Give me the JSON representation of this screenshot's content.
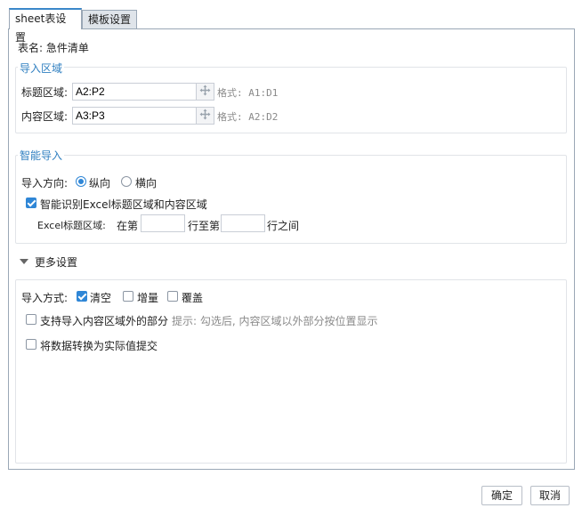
{
  "tabs": [
    {
      "label": "sheet表设置",
      "active": true
    },
    {
      "label": "模板设置",
      "active": false
    }
  ],
  "table_name": "表名: 急件清单",
  "import_area": {
    "title": "导入区域",
    "title_row": {
      "label": "标题区域:",
      "value": "A2:P2",
      "format": "格式: A1:D1"
    },
    "content_row": {
      "label": "内容区域:",
      "value": "A3:P3",
      "format": "格式: A2:D2"
    }
  },
  "smart_import": {
    "title": "智能导入",
    "direction_label": "导入方向:",
    "direction_options": [
      {
        "label": "纵向",
        "checked": true
      },
      {
        "label": "横向",
        "checked": false
      }
    ],
    "auto_detect_label": "智能识别Excel标题区域和内容区域",
    "auto_detect_checked": true,
    "excel_title_label": "Excel标题区域:",
    "row_from_label": "在第",
    "row_from_value": "",
    "row_to_label": "行至第",
    "row_to_value": "",
    "row_end_label": "行之间"
  },
  "more_settings": {
    "title": "更多设置",
    "import_mode_label": "导入方式:",
    "import_modes": [
      {
        "label": "清空",
        "checked": true
      },
      {
        "label": "增量",
        "checked": false
      },
      {
        "label": "覆盖",
        "checked": false
      }
    ],
    "outside_area_label": "支持导入内容区域外的部分",
    "outside_area_checked": false,
    "outside_area_hint": "提示: 勾选后, 内容区域以外部分按位置显示",
    "convert_label": "将数据转换为实际值提交",
    "convert_checked": false
  },
  "footer": {
    "ok_label": "确定",
    "cancel_label": "取消"
  },
  "colors": {
    "accent": "#2f86d6",
    "group_title": "#2f7fc0"
  }
}
